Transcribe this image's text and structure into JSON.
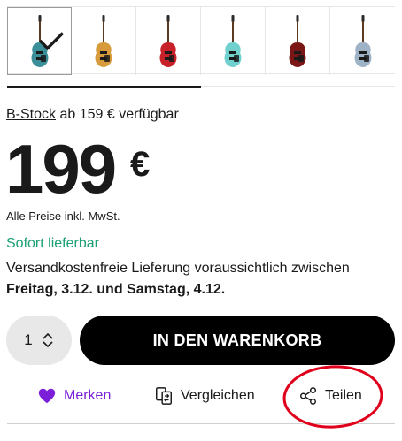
{
  "swatches": [
    {
      "body": "#3a8f99",
      "selected": true
    },
    {
      "body": "#d79b3c",
      "selected": false
    },
    {
      "body": "#c7222a",
      "selected": false
    },
    {
      "body": "#6fd0cd",
      "selected": false
    },
    {
      "body": "#7a1616",
      "selected": false
    },
    {
      "body": "#9fb3c6",
      "selected": false
    }
  ],
  "carousel_progress": 0.5,
  "bstock": {
    "link": "B-Stock",
    "rest": " ab 159 € verfügbar"
  },
  "price": {
    "amount": "199",
    "currency": "€"
  },
  "vat_note": "Alle Preise inkl. MwSt.",
  "availability": "Sofort lieferbar",
  "delivery": {
    "text": "Versandkostenfreie Lieferung voraussichtlich zwischen",
    "dates": "Freitag, 3.12. und Samstag, 4.12."
  },
  "quantity": "1",
  "cart_button": "IN DEN WARENKORB",
  "actions": {
    "merken": "Merken",
    "vergleichen": "Vergleichen",
    "teilen": "Teilen"
  },
  "colors": {
    "accent_purple": "#7b1fd8",
    "available_green": "#1aa071",
    "annotation_red": "#e0001b"
  },
  "icons": [
    "heart-icon",
    "compare-icon",
    "share-icon",
    "updown-chevron-icon",
    "checkmark-icon"
  ]
}
